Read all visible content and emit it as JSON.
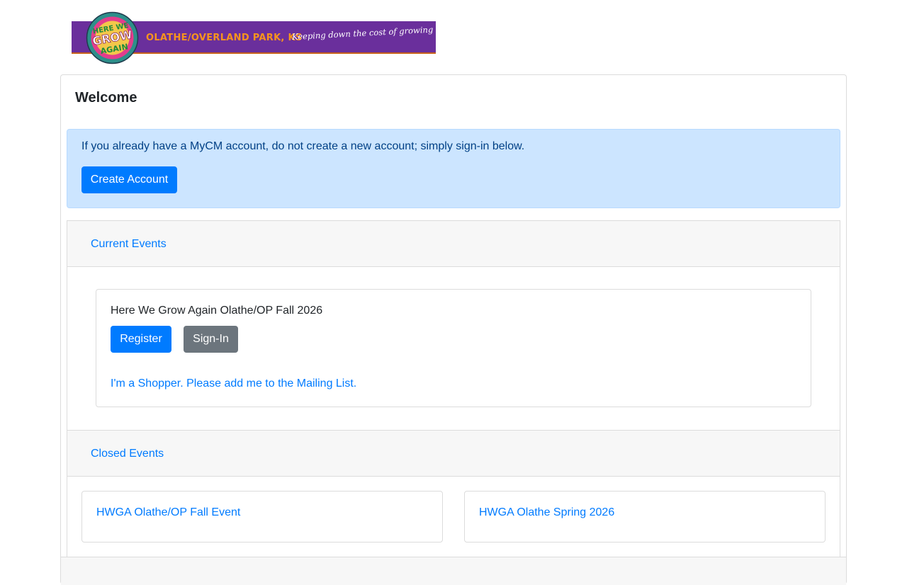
{
  "banner": {
    "city_text": "OLATHE/OVERLAND PARK, KS",
    "tagline": "Keeping down the cost of growing up!",
    "logo_lines": [
      "HERE WE",
      "GROW",
      "AGAIN"
    ],
    "colors": {
      "bar": "#6a2f9c",
      "city": "#f7941d",
      "logo_outer": "#2d8f8a",
      "logo_inner": "#e23d8c"
    }
  },
  "main": {
    "title": "Welcome",
    "alert": {
      "text": "If you already have a MyCM account, do not create a new account; simply sign-in below.",
      "create_account_label": "Create Account"
    }
  },
  "current_events": {
    "header": "Current Events",
    "events": [
      {
        "title": "Here We Grow Again Olathe/OP Fall 2026",
        "register_label": "Register",
        "signin_label": "Sign-In",
        "mailing_link": "I'm a Shopper. Please add me to the Mailing List."
      }
    ]
  },
  "closed_events": {
    "header": "Closed Events",
    "events": [
      {
        "title": "HWGA Olathe/OP Fall Event"
      },
      {
        "title": "HWGA Olathe Spring 2026"
      }
    ]
  },
  "colors": {
    "primary": "#007bff",
    "secondary": "#6c757d",
    "alert_bg": "#cce5ff",
    "alert_text": "#004085"
  }
}
